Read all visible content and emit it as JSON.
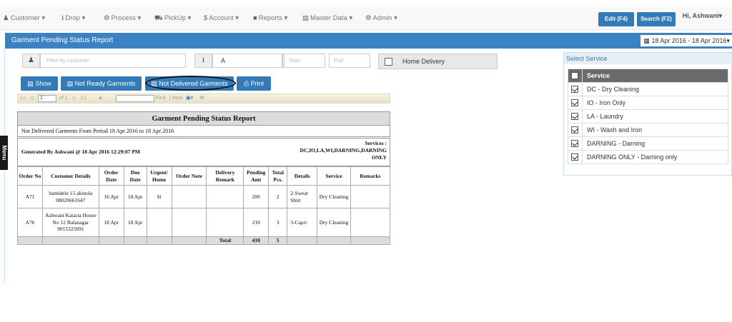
{
  "nav": {
    "items": [
      {
        "label": "Customer",
        "icon": "user-icon"
      },
      {
        "label": "Drop",
        "icon": "download-icon"
      },
      {
        "label": "Process",
        "icon": "trophy-icon"
      },
      {
        "label": "PickUp",
        "icon": "car-icon"
      },
      {
        "label": "Account",
        "icon": "dollar-icon"
      },
      {
        "label": "Reports",
        "icon": "book-icon"
      },
      {
        "label": "Master Data",
        "icon": "list-icon"
      },
      {
        "label": "Admin",
        "icon": "gear-icon"
      }
    ],
    "edit_button": "Edit (F4)",
    "search_button": "Search (F2)",
    "greeting": "Hi, Ashwani"
  },
  "page": {
    "title": "Garment Pending Status Report",
    "date_range": "18 Apr 2016 - 18 Apr 2016",
    "menu_tab": "Menu"
  },
  "filters": {
    "customer_placeholder": "Filter by customer",
    "store_value": "A",
    "start_placeholder": "Start",
    "end_placeholder": "End",
    "home_delivery_label": "Home Delivery"
  },
  "buttons": {
    "show": "Show",
    "not_ready": "Not Ready Garments",
    "not_delivered": "Not Delivered Garments",
    "print": "Print"
  },
  "toolbar": {
    "page_value": "1",
    "page_of": "of 1",
    "find": "Find",
    "next": "Next"
  },
  "report": {
    "title": "Garment Pending Status Report",
    "subtitle": "Not Delivered Garments   From Period 18 Apr 2016 to 18 Apr 2016",
    "generated": "Generated By Ashwani @ 18 Apr 2016 12:29:07 PM",
    "services_label": "Services :",
    "services_value": "DC,IO,LA,WI,DARNING,DARNING ONLY",
    "columns": [
      "Order No",
      "Customer Details",
      "Order Date",
      "Due Date",
      "Urgent/ Home",
      "Order Note",
      "Delivery Remark",
      "Pending Amt",
      "Total Pcs.",
      "Details",
      "Service",
      "Remarks"
    ],
    "rows": [
      [
        "A71",
        "bamidele 15 akinola 08020661647",
        "16 Apr",
        "18 Apr",
        "H",
        "",
        "",
        "200",
        "2",
        "2-Sweat Shirt",
        "Dry Cleaning",
        ""
      ],
      [
        "A76",
        "Ashwani Kataria House No 12 Balanagar 9015325691",
        "18 Apr",
        "18 Apr",
        "",
        "",
        "",
        "210",
        "3",
        "3-Capri",
        "Dry Cleaning",
        ""
      ]
    ],
    "total_label": "Total",
    "total_amt": "410",
    "total_pcs": "5"
  },
  "services": {
    "title": "Select Service",
    "header": "Service",
    "items": [
      {
        "label": "DC -  Dry Cleaning",
        "checked": true
      },
      {
        "label": "IO -  Iron Only",
        "checked": true
      },
      {
        "label": "LA -  Laundry",
        "checked": true
      },
      {
        "label": "WI -  Wash and Iron",
        "checked": true
      },
      {
        "label": "DARNING -  Darning",
        "checked": true
      },
      {
        "label": "DARNING ONLY -  Darning only",
        "checked": true
      }
    ]
  },
  "colors": {
    "brand": "#337ab7",
    "title_bar": "#3b82c4",
    "table_header": "#6b6b6b"
  }
}
